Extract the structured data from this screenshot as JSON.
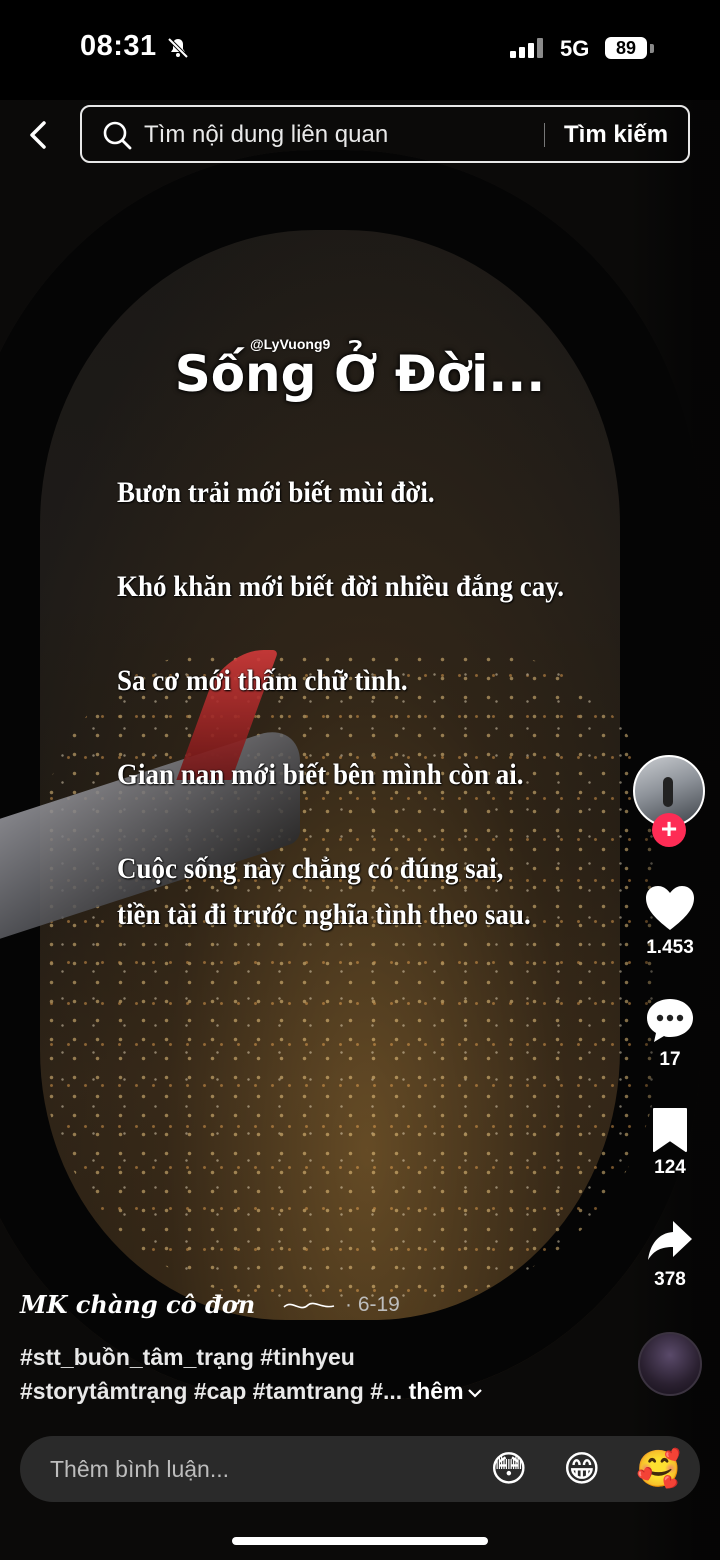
{
  "status_bar": {
    "time": "08:31",
    "network": "5G",
    "battery": "89",
    "icons": [
      "bell-slash-icon",
      "signal-bars-icon",
      "battery-icon"
    ]
  },
  "search": {
    "placeholder": "Tìm nội dung liên quan",
    "button": "Tìm kiếm"
  },
  "video_overlay": {
    "title": "Sống Ở Đời...",
    "watermark": "@LyVuong9",
    "lines": [
      "Bươn trải mới biết mùi đời.",
      "Khó khăn mới biết đời nhiều đắng cay.",
      "Sa cơ mới thấm chữ tình.",
      "Gian nan mới biết bên mình còn ai.",
      "Cuộc sống này chẳng có đúng sai,",
      "tiền tài đi trước nghĩa tình theo sau."
    ]
  },
  "actions": {
    "likes": "1.453",
    "comments": "17",
    "saves": "124",
    "shares": "378",
    "follow_symbol": "+"
  },
  "post": {
    "author": "MK chàng cô đơn",
    "date": "· 6-19",
    "hashtags_line1": "#stt_buồn_tâm_trạng #tinhyeu",
    "hashtags_line2": "#storytâmtrạng #cap #tamtrang #...",
    "more": "thêm"
  },
  "comment_bar": {
    "placeholder": "Thêm bình luận...",
    "emojis": [
      "😳",
      "😁",
      "🥰"
    ]
  },
  "colors": {
    "accent": "#fe2c55",
    "background": "#000000",
    "input_bg": "#2a2a2a"
  }
}
